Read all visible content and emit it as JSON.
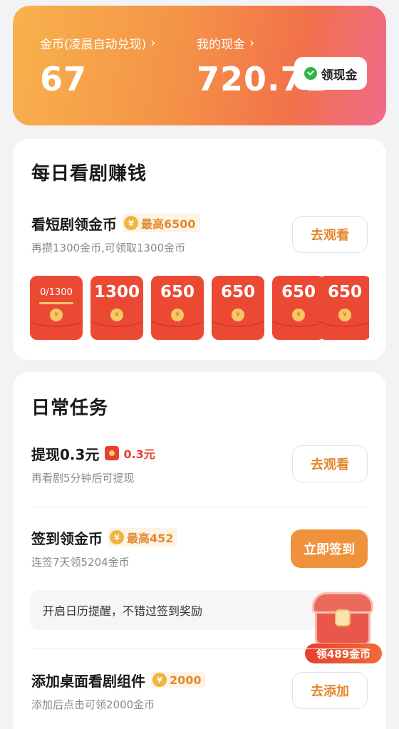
{
  "header": {
    "coin_label": "金币(凌晨自动兑现)",
    "coin_value": "67",
    "cash_label": "我的现金",
    "cash_value": "720.71",
    "withdraw_button": "领现金"
  },
  "daily": {
    "title": "每日看剧赚钱",
    "task": {
      "title": "看短剧领金币",
      "tag": "最高6500",
      "subtitle": "再攒1300金币,可领取1300金币",
      "button": "去观看"
    },
    "envelopes": [
      "0/1300",
      "1300",
      "650",
      "650",
      "650",
      "650"
    ]
  },
  "tasks": {
    "title": "日常任务",
    "items": [
      {
        "title": "提现0.3元",
        "tag": "0.3元",
        "subtitle": "再看剧5分钟后可提现",
        "button": "去观看"
      },
      {
        "title": "签到领金币",
        "tag": "最高452",
        "subtitle": "连签7天领5204金币",
        "button": "立即签到"
      },
      {
        "title": "添加桌面看剧组件",
        "tag": "2000",
        "subtitle": "添加后点击可领2000金币",
        "button": "去添加"
      }
    ],
    "reminder": "开启日历提醒，不错过签到奖励",
    "chest_label": "领489金币"
  },
  "icons": {
    "coin_symbol": "¥",
    "chevron": "›"
  },
  "colors": {
    "accent": "#f0913b",
    "red": "#ec4934",
    "coin": "#f2b440"
  }
}
